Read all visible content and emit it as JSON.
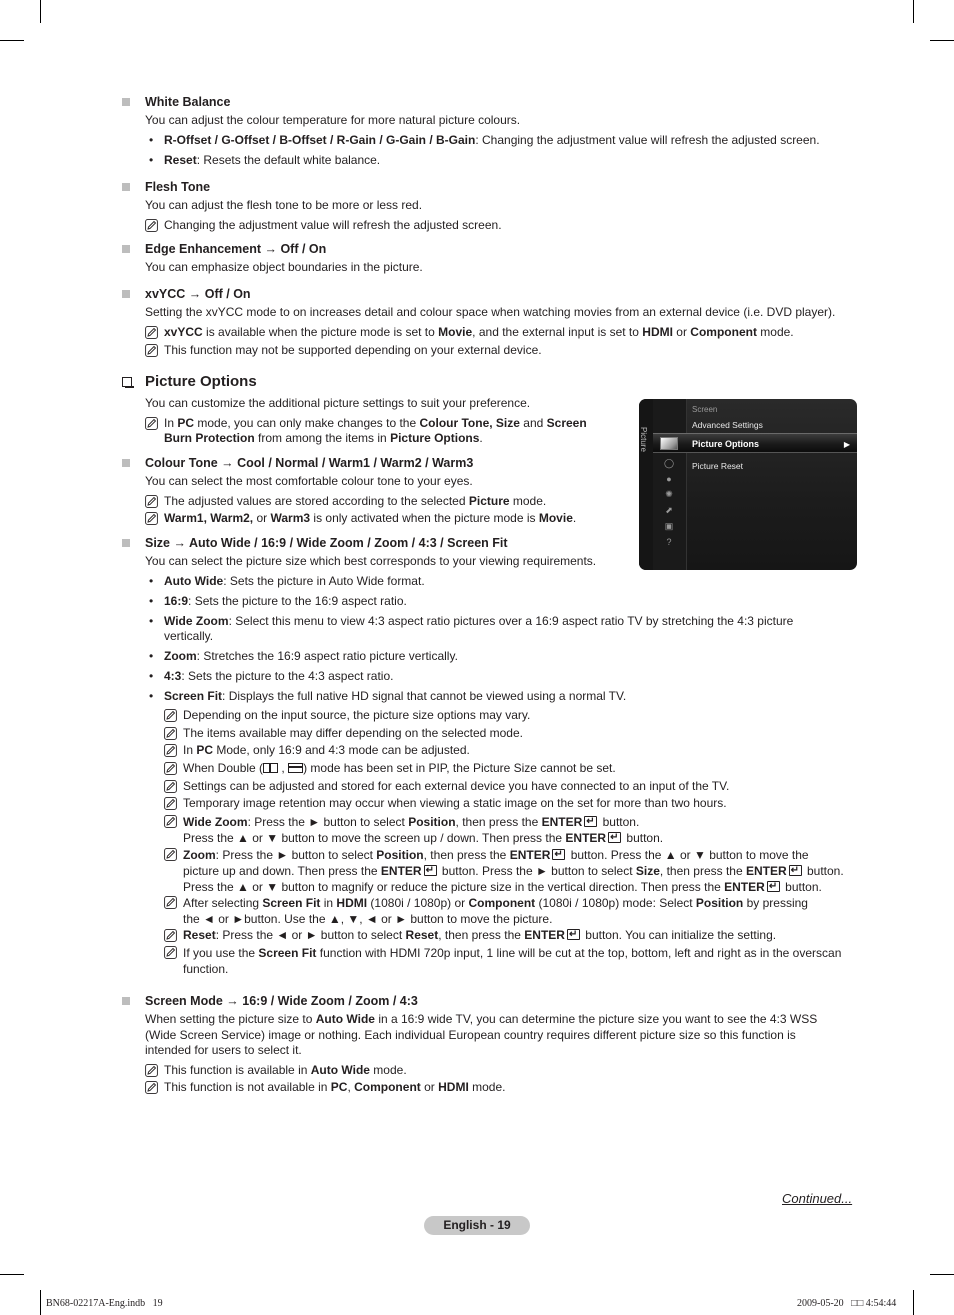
{
  "white_balance": {
    "title": "White Balance",
    "desc": "You can adjust the colour temperature for more natural picture colours.",
    "bullets": [
      {
        "term": "R-Offset / G-Offset / B-Offset / R-Gain / G-Gain / B-Gain",
        "text": ": Changing the adjustment value will refresh the adjusted screen."
      },
      {
        "term": "Reset",
        "text": ": Resets the default white balance."
      }
    ]
  },
  "flesh_tone": {
    "title": "Flesh Tone",
    "desc": "You can adjust the flesh tone to be more or less red.",
    "note": "Changing the adjustment value will refresh the adjusted screen."
  },
  "edge": {
    "title": "Edge Enhancement → Off / On",
    "desc": "You can emphasize object boundaries in the picture."
  },
  "xvycc": {
    "title": "xvYCC → Off / On",
    "desc": "Setting the xvYCC mode to on increases detail and colour space when watching movies from an external device (i.e. DVD player).",
    "note1": {
      "a": "xvYCC",
      "b": " is available when the picture mode is set to ",
      "c": "Movie",
      "d": ", and the external input is set to ",
      "e": "HDMI",
      "f": " or ",
      "g": "Component",
      "h": " mode."
    },
    "note2": "This function may not be supported depending on your external device."
  },
  "picture_options": {
    "title": "Picture Options",
    "desc": "You can customize the additional picture settings to suit your preference.",
    "note": {
      "a": "In ",
      "b": "PC",
      "c": " mode, you can only make changes to the ",
      "d": "Colour Tone, Size",
      "e": " and ",
      "f": "Screen",
      "g": "Burn Protection",
      "h": " from among the items in ",
      "i": "Picture Options",
      "j": "."
    }
  },
  "osd": {
    "side_label": "Picture",
    "items": [
      "Screen",
      "Advanced Settings",
      "Picture Options",
      "Picture Reset"
    ],
    "selected_arrow": "▶"
  },
  "colour_tone": {
    "title": "Colour Tone → Cool / Normal / Warm1 / Warm2 / Warm3",
    "desc": "You can select the most comfortable colour tone to your eyes.",
    "note1": {
      "a": "The adjusted values are stored according to the selected ",
      "b": "Picture",
      "c": " mode."
    },
    "note2": {
      "a": "Warm1, Warm2,",
      "b": " or ",
      "c": "Warm3",
      "d": " is only activated when the picture mode is ",
      "e": "Movie",
      "f": "."
    }
  },
  "size": {
    "title": "Size → Auto Wide / 16:9 / Wide Zoom / Zoom / 4:3 / Screen Fit",
    "desc": "You can select the picture size which best corresponds to your viewing requirements.",
    "bullets": [
      {
        "term": "Auto Wide",
        "text": ": Sets the picture in Auto Wide format."
      },
      {
        "term": "16:9",
        "text": ": Sets the picture to the 16:9 aspect ratio."
      },
      {
        "term": "Wide Zoom",
        "text": ": Select this menu to view 4:3 aspect ratio pictures over a 16:9 aspect ratio TV by stretching the 4:3 picture",
        "text2": "vertically."
      },
      {
        "term": "Zoom",
        "text": ": Stretches the 16:9 aspect ratio picture vertically."
      },
      {
        "term": "4:3",
        "text": ": Sets the picture to the 4:3 aspect ratio."
      },
      {
        "term": "Screen Fit",
        "text": ": Displays the full native HD signal that cannot be viewed using a normal TV."
      }
    ],
    "notes": {
      "n1": "Depending on the input source, the picture size options may vary.",
      "n2": "The items available may differ depending on the selected mode.",
      "n3": {
        "a": "In ",
        "b": "PC",
        "c": " Mode, only 16:9 and 4:3 mode can be adjusted."
      },
      "n4": {
        "a": "When Double (",
        "b": " , ",
        "c": ") mode has been set in PIP, the Picture Size cannot be set."
      },
      "n5": "Settings can be adjusted and stored for each external device you have connected to an input of the TV.",
      "n6": "Temporary image retention may occur when viewing a static image on the set for more than two hours.",
      "n7": {
        "a": "Wide Zoom",
        "b": ": Press the ► button to select ",
        "c": "Position",
        "d": ", then press the ",
        "e": "ENTER",
        "f": " button.",
        "g": "Press the ▲ or ▼ button to move the screen up / down. Then press the ",
        "h": "ENTER",
        "i": " button."
      },
      "n8": {
        "a": "Zoom",
        "b": ": Press the ► button to select ",
        "c": "Position",
        "d": ", then press the ",
        "e": "ENTER",
        "f": " button. Press the ▲ or ▼ button to move the",
        "g": "picture up and down. Then press the ",
        "h": "ENTER",
        "i": " button. Press the ► button to select ",
        "j": "Size",
        "k": ", then press the ",
        "l": "ENTER",
        "m": " button.",
        "n": "Press the ▲ or ▼ button to magnify or reduce the picture size in the vertical direction. Then press the ",
        "o": "ENTER",
        "p": " button."
      },
      "n9": {
        "a": "After selecting ",
        "b": "Screen Fit",
        "c": " in ",
        "d": "HDMI",
        "e": " (1080i / 1080p) or ",
        "f": "Component",
        "g": " (1080i / 1080p) mode: Select ",
        "h": "Position",
        "i": " by pressing",
        "j": "the ◄ or ►button. Use the ▲, ▼, ◄ or ► button to move the picture."
      },
      "n10": {
        "a": "Reset",
        "b": ": Press the ◄ or ► button to select ",
        "c": "Reset",
        "d": ", then press the ",
        "e": "ENTER",
        "f": " button. You can initialize the setting."
      },
      "n11": {
        "a": "If you use the ",
        "b": "Screen Fit",
        "c": " function with HDMI 720p input, 1 line will be cut at the top, bottom, left and right as in the overscan",
        "d": "function."
      }
    }
  },
  "screen_mode": {
    "title": "Screen Mode → 16:9 / Wide Zoom / Zoom / 4:3",
    "desc": {
      "a": "When setting the picture size to ",
      "b": "Auto Wide",
      "c": " in a 16:9 wide TV, you can determine the picture size you want to see the 4:3 WSS",
      "d": "(Wide Screen Service) image or nothing. Each individual European country requires different picture size so this function is",
      "e": "intended for users to select it."
    },
    "note1": {
      "a": "This function is available in ",
      "b": "Auto Wide",
      "c": " mode."
    },
    "note2": {
      "a": "This function is not available in ",
      "b": "PC",
      "c": ", ",
      "d": "Component",
      "e": " or ",
      "f": "HDMI",
      "g": " mode."
    }
  },
  "footer": {
    "continued": "Continued...",
    "page": "English - 19",
    "file": "BN68-02217A-Eng.indb   19",
    "date": "2009-05-20   □□ 4:54:44"
  }
}
